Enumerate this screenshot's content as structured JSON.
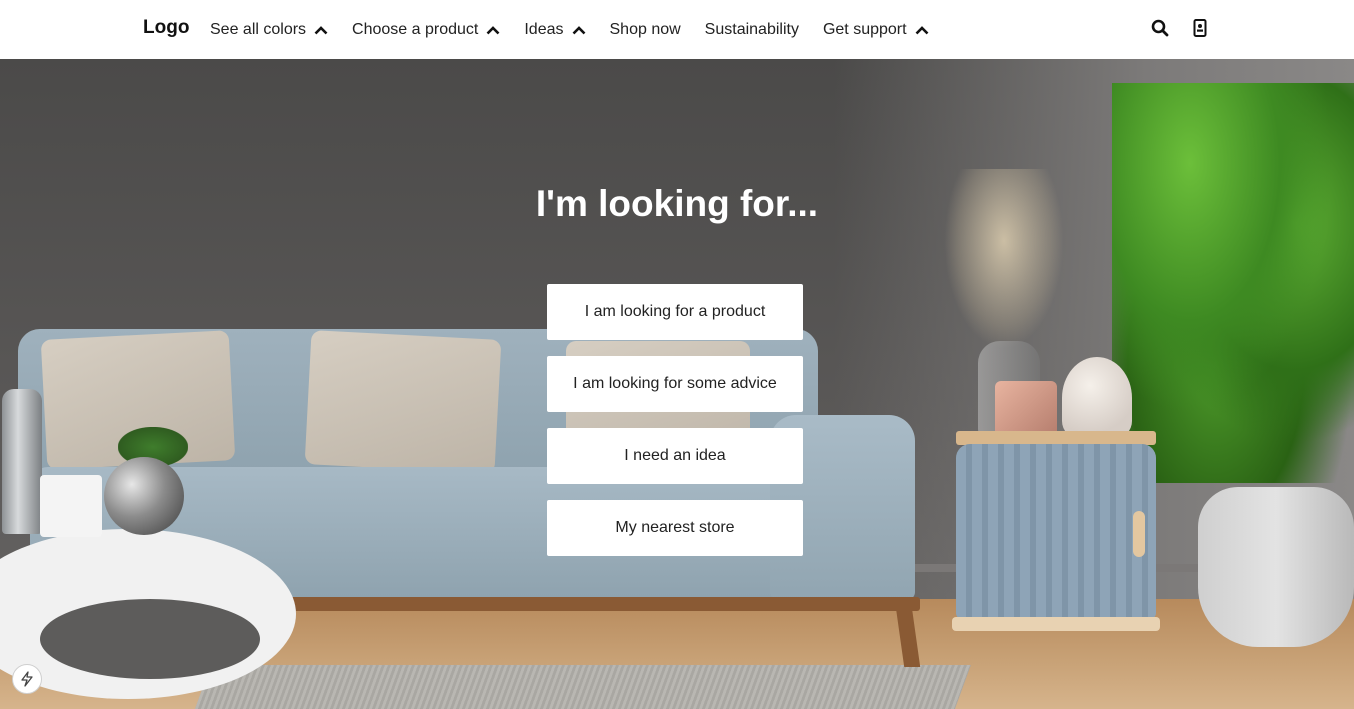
{
  "header": {
    "logo": "Logo",
    "nav": [
      {
        "label": "See all colors",
        "has_dropdown": true
      },
      {
        "label": "Choose a product",
        "has_dropdown": true
      },
      {
        "label": "Ideas",
        "has_dropdown": true
      },
      {
        "label": "Shop now",
        "has_dropdown": false
      },
      {
        "label": "Sustainability",
        "has_dropdown": false
      },
      {
        "label": "Get support",
        "has_dropdown": true
      }
    ],
    "icons": [
      "search-icon",
      "contact-card-icon"
    ]
  },
  "hero": {
    "title": "I'm looking for...",
    "options": [
      "I am looking for a product",
      "I am looking for some advice",
      "I need an idea",
      "My nearest store"
    ],
    "background": "living room with light blue sofa, side cabinet and plant"
  },
  "badge": {
    "icon": "lightning-icon"
  },
  "colors": {
    "header_bg": "#ffffff",
    "button_bg": "#ffffff",
    "hero_wall": "#595857",
    "title_text": "#ffffff"
  }
}
